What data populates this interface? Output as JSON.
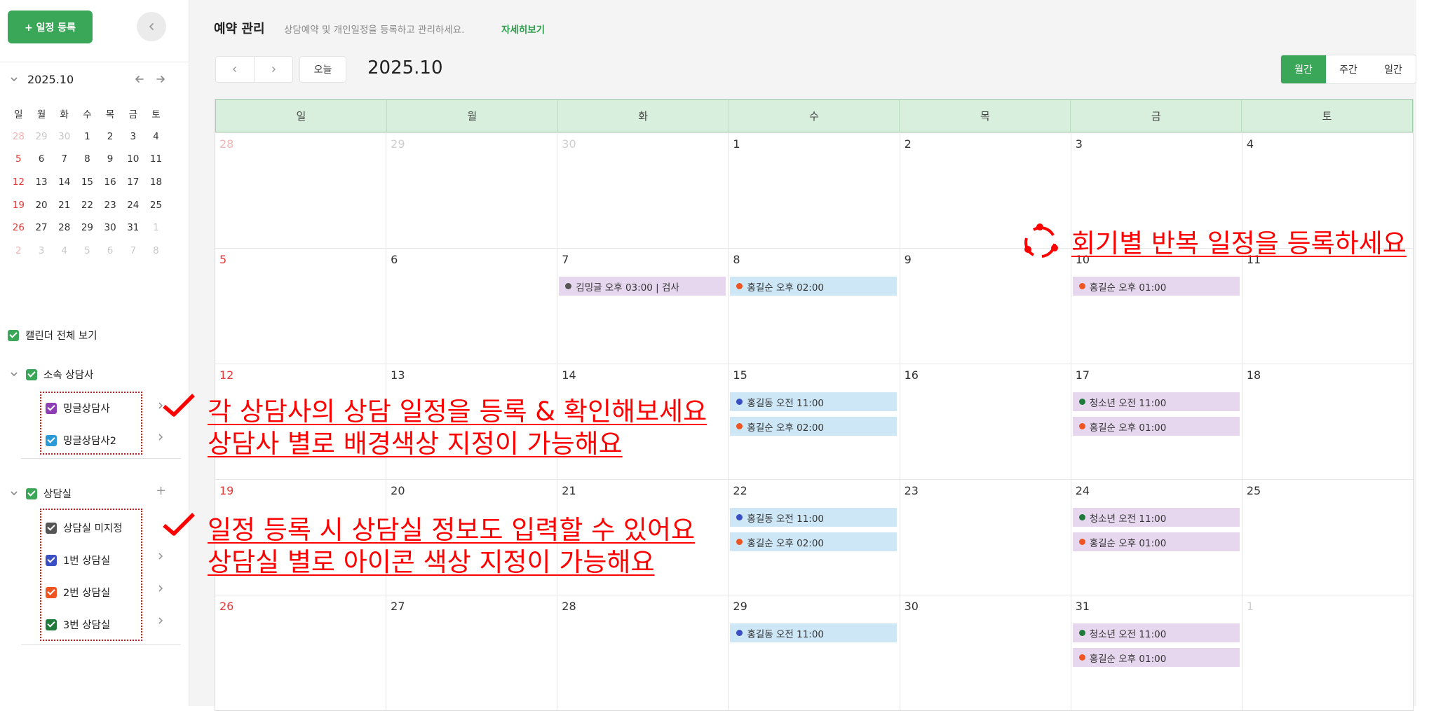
{
  "sidebar": {
    "new_button_label": "+ 일정 등록",
    "mini_calendar": {
      "month_label": "2025.10",
      "weekdays": [
        "일",
        "월",
        "화",
        "수",
        "목",
        "금",
        "토"
      ],
      "weeks": [
        [
          "28",
          "29",
          "30",
          "1",
          "2",
          "3",
          "4"
        ],
        [
          "5",
          "6",
          "7",
          "8",
          "9",
          "10",
          "11"
        ],
        [
          "12",
          "13",
          "14",
          "15",
          "16",
          "17",
          "18"
        ],
        [
          "19",
          "20",
          "21",
          "22",
          "23",
          "24",
          "25"
        ],
        [
          "26",
          "27",
          "28",
          "29",
          "30",
          "31",
          "1"
        ],
        [
          "2",
          "3",
          "4",
          "5",
          "6",
          "7",
          "8"
        ]
      ]
    },
    "show_all_label": "캘린더 전체 보기",
    "counselor_group": {
      "label": "소속 상담사",
      "items": [
        {
          "label": "밍글상담사",
          "color": "#8e3fb5"
        },
        {
          "label": "밍글상담사2",
          "color": "#2c9ad6"
        }
      ]
    },
    "room_group": {
      "label": "상담실",
      "items": [
        {
          "label": "상담실 미지정",
          "color": "#555555"
        },
        {
          "label": "1번 상담실",
          "color": "#3b4fc4"
        },
        {
          "label": "2번 상담실",
          "color": "#ee5522"
        },
        {
          "label": "3번 상담실",
          "color": "#1f7a3c"
        }
      ]
    }
  },
  "header": {
    "title": "예약 관리",
    "description": "상담예약 및 개인일정을 등록하고 관리하세요.",
    "more_link": "자세히보기"
  },
  "toolbar": {
    "prev": "‹",
    "next": "›",
    "today_label": "오늘",
    "current_label": "2025.10",
    "views": [
      "월간",
      "주간",
      "일간"
    ],
    "active_view": "월간"
  },
  "calendar": {
    "weekdays": [
      "일",
      "월",
      "화",
      "수",
      "목",
      "금",
      "토"
    ],
    "weeks": [
      {
        "days": [
          {
            "num": "28",
            "style": "dimsun"
          },
          {
            "num": "29",
            "style": "dim"
          },
          {
            "num": "30",
            "style": "dim"
          },
          {
            "num": "1"
          },
          {
            "num": "2"
          },
          {
            "num": "3"
          },
          {
            "num": "4"
          }
        ]
      },
      {
        "days": [
          {
            "num": "5",
            "style": "sun"
          },
          {
            "num": "6"
          },
          {
            "num": "7",
            "events": [
              {
                "text": "김밍글 오후 03:00 | 검사",
                "bg": "purple",
                "dot": "#555555"
              }
            ]
          },
          {
            "num": "8",
            "events": [
              {
                "text": "홍길순 오후 02:00",
                "bg": "blue",
                "dot": "#ee5522"
              }
            ]
          },
          {
            "num": "9"
          },
          {
            "num": "10",
            "events": [
              {
                "text": "홍길순 오후 01:00",
                "bg": "purple",
                "dot": "#ee5522"
              }
            ]
          },
          {
            "num": "11"
          }
        ]
      },
      {
        "days": [
          {
            "num": "12",
            "style": "sun"
          },
          {
            "num": "13"
          },
          {
            "num": "14"
          },
          {
            "num": "15",
            "events": [
              {
                "text": "홍길동 오전 11:00",
                "bg": "blue",
                "dot": "#3b4fc4"
              },
              {
                "text": "홍길순 오후 02:00",
                "bg": "blue",
                "dot": "#ee5522"
              }
            ]
          },
          {
            "num": "16"
          },
          {
            "num": "17",
            "events": [
              {
                "text": "청소년 오전 11:00",
                "bg": "purple",
                "dot": "#1f7a3c"
              },
              {
                "text": "홍길순 오후 01:00",
                "bg": "purple",
                "dot": "#ee5522"
              }
            ]
          },
          {
            "num": "18"
          }
        ]
      },
      {
        "days": [
          {
            "num": "19",
            "style": "sun"
          },
          {
            "num": "20"
          },
          {
            "num": "21"
          },
          {
            "num": "22",
            "events": [
              {
                "text": "홍길동 오전 11:00",
                "bg": "blue",
                "dot": "#3b4fc4"
              },
              {
                "text": "홍길순 오후 02:00",
                "bg": "blue",
                "dot": "#ee5522"
              }
            ]
          },
          {
            "num": "23"
          },
          {
            "num": "24",
            "events": [
              {
                "text": "청소년 오전 11:00",
                "bg": "purple",
                "dot": "#1f7a3c"
              },
              {
                "text": "홍길순 오후 01:00",
                "bg": "purple",
                "dot": "#ee5522"
              }
            ]
          },
          {
            "num": "25"
          }
        ]
      },
      {
        "days": [
          {
            "num": "26",
            "style": "sun"
          },
          {
            "num": "27"
          },
          {
            "num": "28"
          },
          {
            "num": "29",
            "events": [
              {
                "text": "홍길동 오전 11:00",
                "bg": "blue",
                "dot": "#3b4fc4"
              }
            ]
          },
          {
            "num": "30"
          },
          {
            "num": "31",
            "events": [
              {
                "text": "청소년 오전 11:00",
                "bg": "purple",
                "dot": "#1f7a3c"
              },
              {
                "text": "홍길순 오후 01:00",
                "bg": "purple",
                "dot": "#ee5522"
              }
            ]
          },
          {
            "num": "1",
            "style": "dim"
          }
        ]
      }
    ]
  },
  "annotations": {
    "repeat": "회기별 반복 일정을 등록하세요",
    "counselor_line1": "각 상담사의 상담 일정을 등록 & 확인해보세요",
    "counselor_line2": "상담사 별로 배경색상 지정이 가능해요",
    "room_line1": "일정 등록 시 상담실 정보도 입력할 수 있어요",
    "room_line2": "상담실 별로 아이콘 색상 지정이 가능해요"
  },
  "colors": {
    "accent": "#3aa657",
    "header_bg": "#d8efdd",
    "annotation": "#ff0000",
    "event_blue": "#cde7f7",
    "event_purple": "#e6d7ef"
  }
}
